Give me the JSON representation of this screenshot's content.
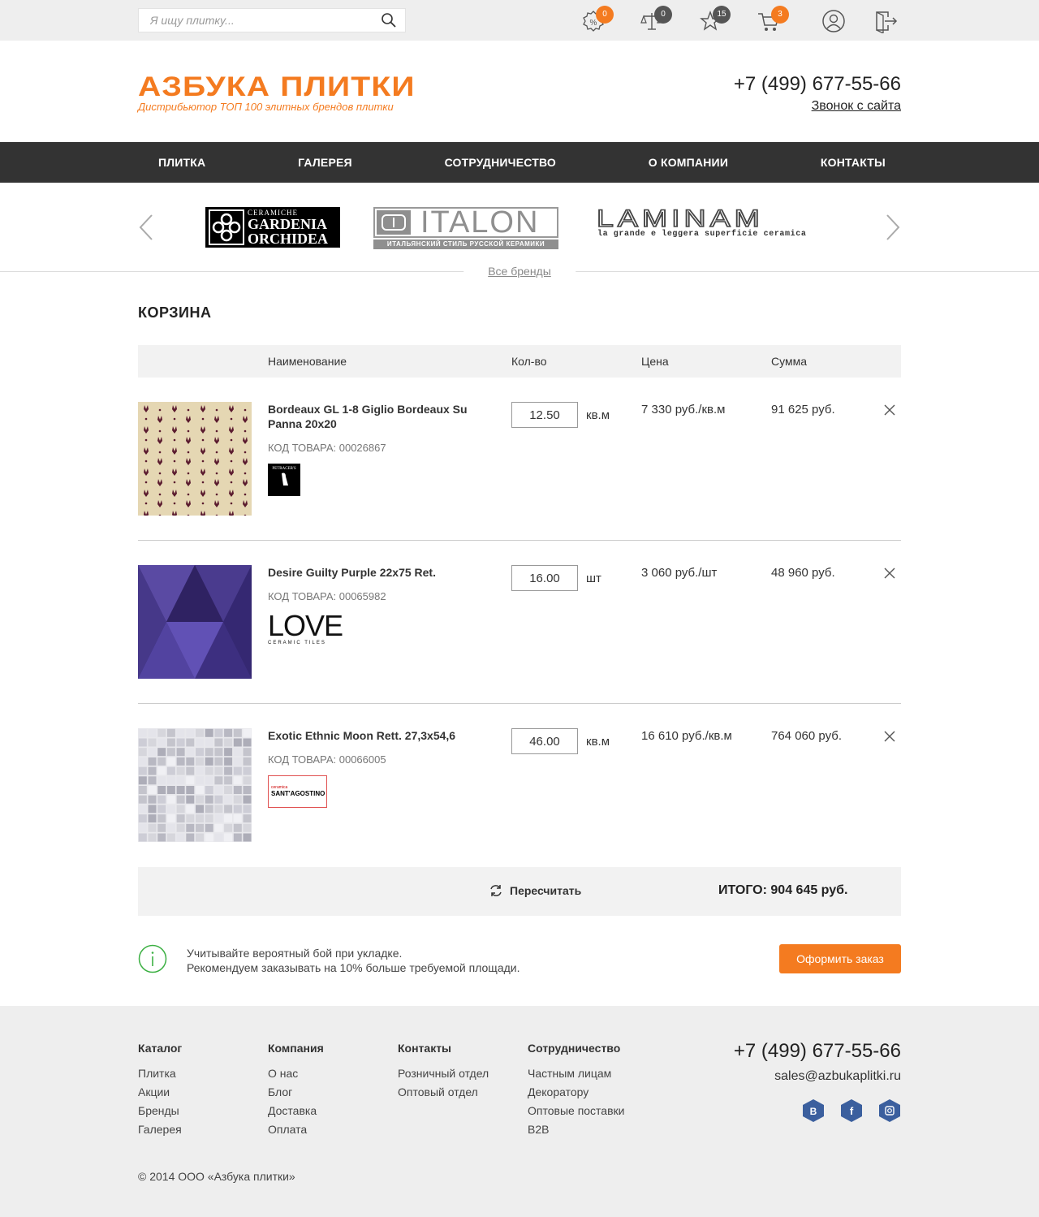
{
  "search": {
    "placeholder": "Я ищу плитку..."
  },
  "top_icons": [
    {
      "name": "discount-icon",
      "badge": "0",
      "badge_color": "#f47b20"
    },
    {
      "name": "compare-icon",
      "badge": "0",
      "badge_color": "#555555"
    },
    {
      "name": "favorites-star-icon",
      "badge": "15",
      "badge_color": "#555555"
    },
    {
      "name": "cart-icon",
      "badge": "3",
      "badge_color": "#f47b20"
    },
    {
      "name": "user-icon"
    },
    {
      "name": "logout-icon"
    }
  ],
  "logo": {
    "title": "АЗБУКА ПЛИТКИ",
    "subtitle": "Дистрибьютор ТОП 100 элитных брендов плитки"
  },
  "header": {
    "phone": "+7 (499) 677-55-66",
    "callback": "Звонок с сайта"
  },
  "nav": [
    "Плитка",
    "Галерея",
    "Сотрудничество",
    "О компании",
    "Контакты"
  ],
  "brands": {
    "logos": [
      {
        "top": "CERAMICHE",
        "line1": "GARDENIA",
        "line2": "ORCHIDEA"
      },
      {
        "main": "ITALON",
        "tagline": "ИТАЛЬЯНСКИЙ СТИЛЬ РУССКОЙ КЕРАМИКИ"
      },
      {
        "main": "LAMINAM",
        "tagline": "la grande e leggera superficie ceramica"
      }
    ],
    "all_link": "Все бренды"
  },
  "cart": {
    "title": "КОРЗИНА",
    "headers": {
      "name": "Наименование",
      "qty": "Кол-во",
      "price": "Цена",
      "sum": "Сумма"
    },
    "items": [
      {
        "name": "Bordeaux GL 1-8 Giglio Bordeaux Su Panna 20x20",
        "code": "КОД ТОВАРА: 00026867",
        "qty": "12.50",
        "unit": "кв.м",
        "price": "7 330 руб./кв.м",
        "sum": "91 625 руб.",
        "brand": "PETRACER'S"
      },
      {
        "name": "Desire Guilty Purple 22x75 Ret.",
        "code": "КОД ТОВАРА: 00065982",
        "qty": "16.00",
        "unit": "шт",
        "price": "3 060 руб./шт",
        "sum": "48 960 руб.",
        "brand": "LOVE",
        "brand_sub": "CERAMIC TILES"
      },
      {
        "name": "Exotic Ethnic Moon Rett. 27,3x54,6",
        "code": "КОД ТОВАРА: 00066005",
        "qty": "46.00",
        "unit": "кв.м",
        "price": "16 610 руб./кв.м",
        "sum": "764 060 руб.",
        "brand_top": "ceramica",
        "brand": "SANT'AGOSTINO"
      }
    ],
    "recalc": "Пересчитать",
    "total": "ИТОГО: 904 645 руб.",
    "note_line1": "Учитывайте вероятный бой при укладке.",
    "note_line2": "Рекомендуем заказывать на 10% больше требуемой площади.",
    "order_button": "Оформить заказ"
  },
  "footer": {
    "columns": [
      {
        "title": "Каталог",
        "links": [
          "Плитка",
          "Акции",
          "Бренды",
          "Галерея"
        ]
      },
      {
        "title": "Компания",
        "links": [
          "О нас",
          "Блог",
          "Доставка",
          "Оплата"
        ]
      },
      {
        "title": "Контакты",
        "links": [
          "Розничный отдел",
          "Оптовый отдел"
        ]
      },
      {
        "title": "Сотрудничество",
        "links": [
          "Частным лицам",
          "Декоратору",
          "Оптовые поставки",
          "B2B"
        ]
      }
    ],
    "phone": "+7 (499) 677-55-66",
    "email": "sales@azbukaplitki.ru",
    "social": [
      "vk-icon",
      "facebook-icon",
      "instagram-icon"
    ],
    "copyright": "© 2014 ООО «Азбука плитки»"
  },
  "colors": {
    "accent": "#f47b20",
    "nav_bg": "#333333",
    "topbar_bg": "#eeeeee",
    "social": "#3b5f9e",
    "info_green": "#3cb043"
  }
}
